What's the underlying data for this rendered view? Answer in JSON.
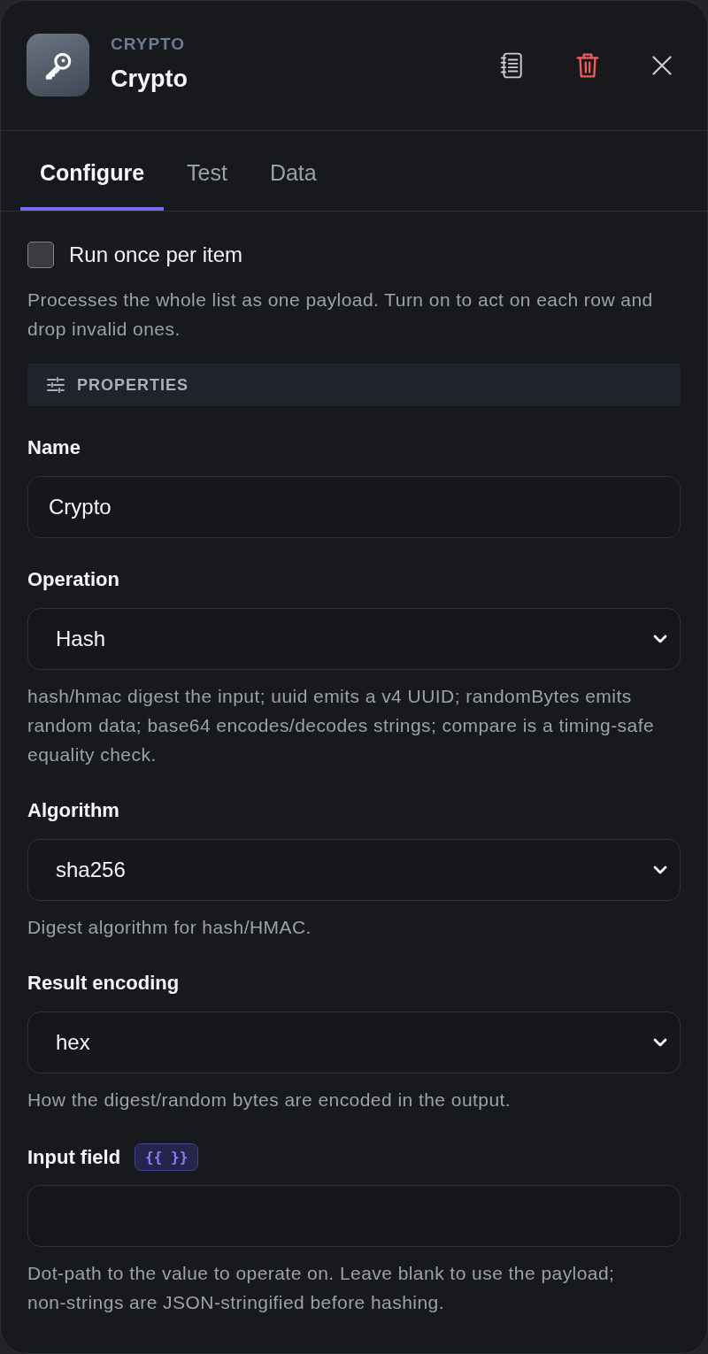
{
  "header": {
    "category": "CRYPTO",
    "title": "Crypto"
  },
  "tabs": [
    {
      "label": "Configure",
      "selected": true
    },
    {
      "label": "Test",
      "selected": false
    },
    {
      "label": "Data",
      "selected": false
    }
  ],
  "run_once": {
    "label": "Run once per item",
    "checked": false,
    "help": "Processes the whole list as one payload. Turn on to act on each row and drop invalid ones."
  },
  "section": {
    "title": "PROPERTIES"
  },
  "fields": [
    {
      "kind": "text",
      "label": "Name",
      "value": "Crypto"
    },
    {
      "kind": "select",
      "label": "Operation",
      "value": "Hash",
      "help": "hash/hmac digest the input; uuid emits a v4 UUID; randomBytes emits random data; base64 encodes/decodes strings; compare is a timing-safe equality check."
    },
    {
      "kind": "select",
      "label": "Algorithm",
      "value": "sha256",
      "help": "Digest algorithm for hash/HMAC."
    },
    {
      "kind": "select",
      "label": "Result encoding",
      "value": "hex",
      "help": "How the digest/random bytes are encoded in the output."
    },
    {
      "kind": "text",
      "label": "Input field",
      "badge": "{{ }}",
      "help": "Dot-path to the value to operate on. Leave blank to use the payload; non-strings are JSON-stringified before hashing."
    }
  ]
}
